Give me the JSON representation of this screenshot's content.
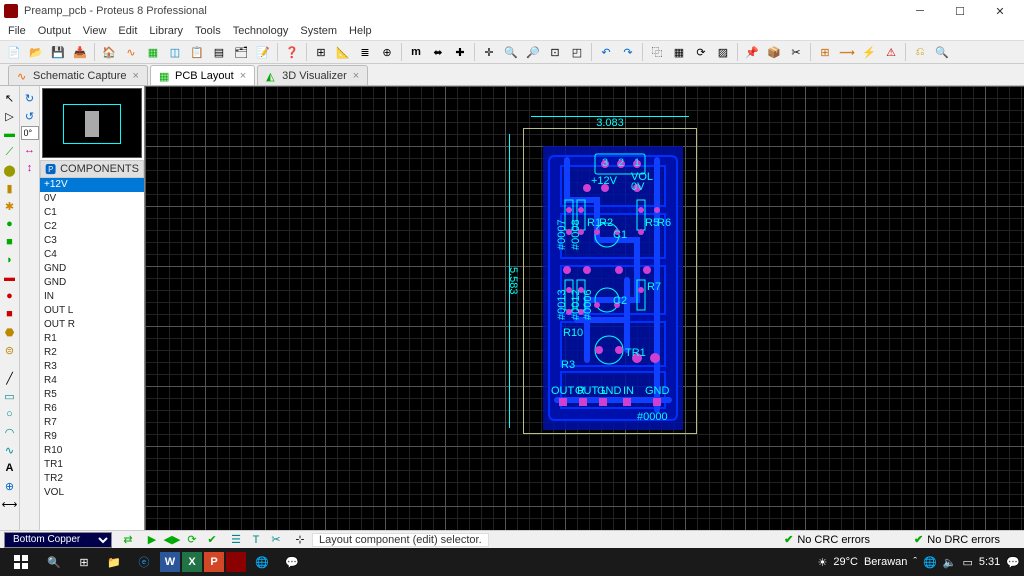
{
  "window": {
    "title": "Preamp_pcb - Proteus 8 Professional"
  },
  "menu": [
    "File",
    "Output",
    "View",
    "Edit",
    "Library",
    "Tools",
    "Technology",
    "System",
    "Help"
  ],
  "tabs": [
    {
      "label": "Schematic Capture",
      "active": false
    },
    {
      "label": "PCB Layout",
      "active": true
    },
    {
      "label": "3D Visualizer",
      "active": false
    }
  ],
  "coord_input": "0°",
  "components_header": "COMPONENTS",
  "components": [
    "+12V",
    "0V",
    "C1",
    "C2",
    "C3",
    "C4",
    "GND",
    "GND",
    "IN",
    "OUT L",
    "OUT R",
    "R1",
    "R2",
    "R3",
    "R4",
    "R5",
    "R6",
    "R7",
    "R9",
    "R10",
    "TR1",
    "TR2",
    "VOL"
  ],
  "selected_component_index": 0,
  "layer": "Bottom Copper",
  "status_message": "Layout component (edit) selector.",
  "crc_status": "No CRC errors",
  "drc_status": "No DRC errors",
  "board": {
    "width_label": "3.083",
    "height_label": "5.583",
    "nets": [
      "#0007",
      "#0008",
      "#0005",
      "#0013",
      "#0012",
      "#0006"
    ],
    "silk_labels": [
      "VOL",
      "+12V",
      "0V",
      "R1",
      "R2",
      "C1",
      "R5",
      "R6",
      "C2",
      "R7",
      "R10",
      "TR1",
      "R3",
      "OUT R",
      "OUT L",
      "GND",
      "IN",
      "GND",
      "#0000"
    ],
    "pad_numbers": [
      "3",
      "2",
      "1"
    ]
  },
  "weather": {
    "temp": "29°C",
    "desc": "Berawan"
  },
  "clock": "5:31"
}
